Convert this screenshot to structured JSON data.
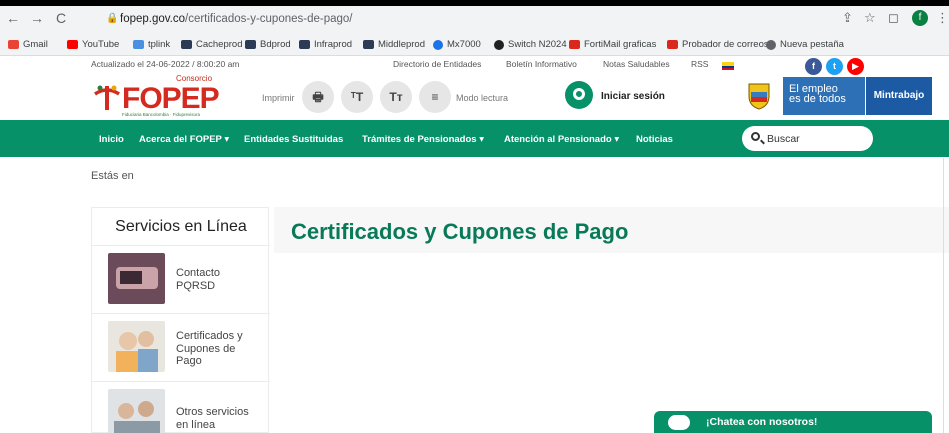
{
  "browser": {
    "back": "←",
    "forward": "→",
    "reload": "C",
    "url_host": "fopep.gov.co",
    "url_path": "/certificados-y-cupones-de-pago/",
    "profile_initial": "f",
    "bookmarks": [
      {
        "label": "Gmail",
        "color": "#ea4335"
      },
      {
        "label": "YouTube",
        "color": "#ff0000"
      },
      {
        "label": "tplink",
        "color": "#4a90e2"
      },
      {
        "label": "Cacheprod",
        "color": "#2b3a55"
      },
      {
        "label": "Bdprod",
        "color": "#2b3a55"
      },
      {
        "label": "Infraprod",
        "color": "#2b3a55"
      },
      {
        "label": "Middleprod",
        "color": "#2b3a55"
      },
      {
        "label": "Mx7000",
        "color": "#1a73e8"
      },
      {
        "label": "Switch N2024",
        "color": "#202124"
      },
      {
        "label": "FortiMail graficas",
        "color": "#da291c"
      },
      {
        "label": "Probador de correos",
        "color": "#da291c"
      },
      {
        "label": "Nueva pestaña",
        "color": "#5f6368"
      }
    ]
  },
  "header": {
    "updated": "Actualizado el 24-06-2022 / 8:00:20 am",
    "links": [
      "Directorio de Entidades",
      "Boletín Informativo",
      "Notas Saludables",
      "RSS"
    ],
    "logo_small": "Consorcio",
    "logo_main": "FOPEP",
    "logo_sub": "Fiduciaria Bancolombia · Fiduprevisora",
    "imprimir": "Imprimir",
    "tools": [
      "🖶",
      "ᵀT",
      "Tт",
      "≡"
    ],
    "modo_lectura": "Modo lectura",
    "login": "Iniciar sesión",
    "empleo_line1": "El empleo",
    "empleo_line2": "es de todos",
    "mintrabajo": "Mintrabajo",
    "colors": {
      "green": "#069169",
      "red": "#d42a1f",
      "blue": "#2d70b5"
    }
  },
  "nav": {
    "items": [
      "Inicio",
      "Acerca del FOPEP ▾",
      "Entidades Sustituidas",
      "Trámites de Pensionados ▾",
      "Atención al Pensionado ▾",
      "Noticias"
    ],
    "search_label": "Buscar"
  },
  "content": {
    "breadcrumb": "Estás en",
    "sidebar_title": "Servicios en Línea",
    "sidebar_items": [
      {
        "line1": "Contacto",
        "line2": "PQRSD",
        "line3": ""
      },
      {
        "line1": "Certificados y",
        "line2": "Cupones de",
        "line3": "Pago"
      },
      {
        "line1": "Otros servicios",
        "line2": "en línea",
        "line3": ""
      }
    ],
    "title": "Certificados y Cupones de Pago",
    "chat": "¡Chatea con nosotros!"
  }
}
